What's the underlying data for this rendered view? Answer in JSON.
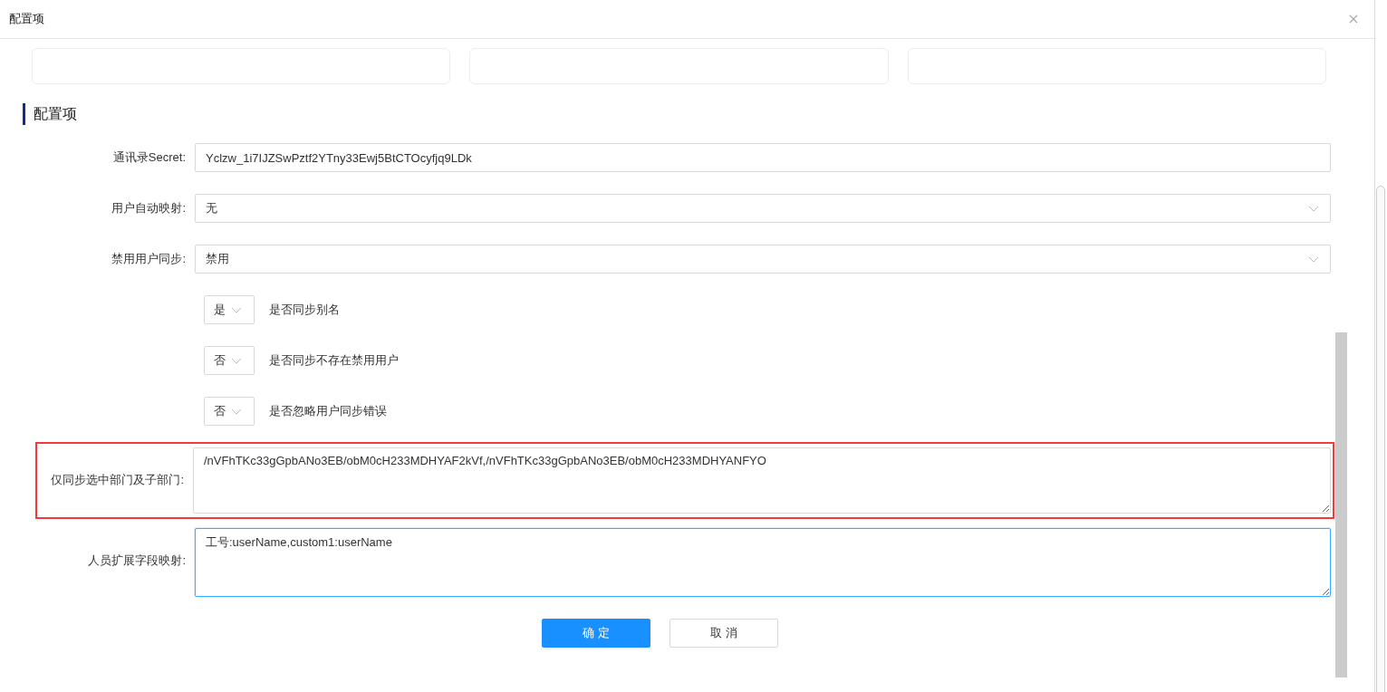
{
  "window": {
    "title": "配置项"
  },
  "top_fields": [
    {
      "kind": "input"
    },
    {
      "kind": "input"
    },
    {
      "kind": "input"
    }
  ],
  "section": {
    "title": "配置项"
  },
  "rows": [
    {
      "kind": "input",
      "label": "通讯录Secret:",
      "value": "Yclzw_1i7IJZSwPztf2YTny33Ewj5BtCTOcyfjq9LDk",
      "highlighted": false
    },
    {
      "kind": "select",
      "label": "用户自动映射:",
      "value": "无",
      "highlighted": false
    },
    {
      "kind": "select",
      "label": "禁用用户同步:",
      "value": "禁用",
      "highlighted": false
    },
    {
      "kind": "toggle",
      "value": "是",
      "text": "是否同步别名"
    },
    {
      "kind": "toggle",
      "value": "否",
      "text": "是否同步不存在禁用用户"
    },
    {
      "kind": "toggle",
      "value": "否",
      "text": "是否忽略用户同步错误"
    },
    {
      "kind": "textarea",
      "label": "仅同步选中部门及子部门:",
      "value": "/nVFhTKc33gGpbANo3EB/obM0cH233MDHYAF2kVf,/nVFhTKc33gGpbANo3EB/obM0cH233MDHYANFYO",
      "highlighted": true,
      "focused": false
    },
    {
      "kind": "textarea",
      "label": "人员扩展字段映射:",
      "value": "工号:userName,custom1:userName",
      "highlighted": false,
      "focused": true
    }
  ],
  "buttons": [
    {
      "label": "确 定",
      "primary": true
    },
    {
      "label": "取 消",
      "primary": false
    }
  ]
}
